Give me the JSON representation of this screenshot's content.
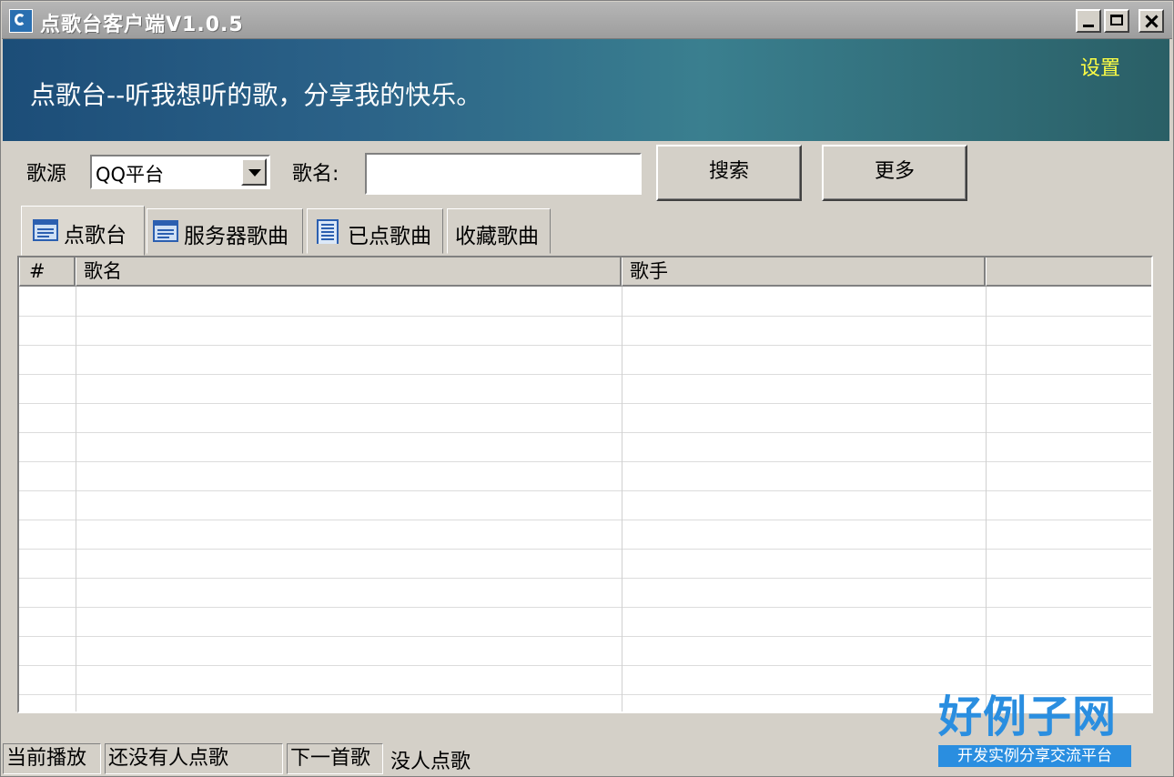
{
  "window": {
    "title": "点歌台客户端V1.0.5",
    "icon": "app-logo-icon"
  },
  "banner": {
    "slogan": "点歌台--听我想听的歌，分享我的快乐。",
    "settings_label": "设置",
    "settings_color": "#ffff44"
  },
  "search": {
    "source_label": "歌源",
    "source_value": "QQ平台",
    "song_label": "歌名:",
    "song_value": "",
    "search_button": "搜索",
    "more_button": "更多"
  },
  "tabs": [
    {
      "label": "点歌台",
      "icon": "list-icon",
      "active": true
    },
    {
      "label": "服务器歌曲",
      "icon": "list-icon",
      "active": false
    },
    {
      "label": "已点歌曲",
      "icon": "document-icon",
      "active": false
    },
    {
      "label": "收藏歌曲",
      "icon": "",
      "active": false
    }
  ],
  "table": {
    "columns": [
      "#",
      "歌名",
      "歌手",
      ""
    ],
    "rows": []
  },
  "status": {
    "now_playing_label": "当前播放",
    "now_playing_value": "还没有人点歌",
    "next_song_label": "下一首歌",
    "next_song_value": "没人点歌"
  },
  "brand": {
    "name": "好例子网",
    "tagline": "开发实例分享交流平台",
    "color": "#2a8ee0"
  }
}
